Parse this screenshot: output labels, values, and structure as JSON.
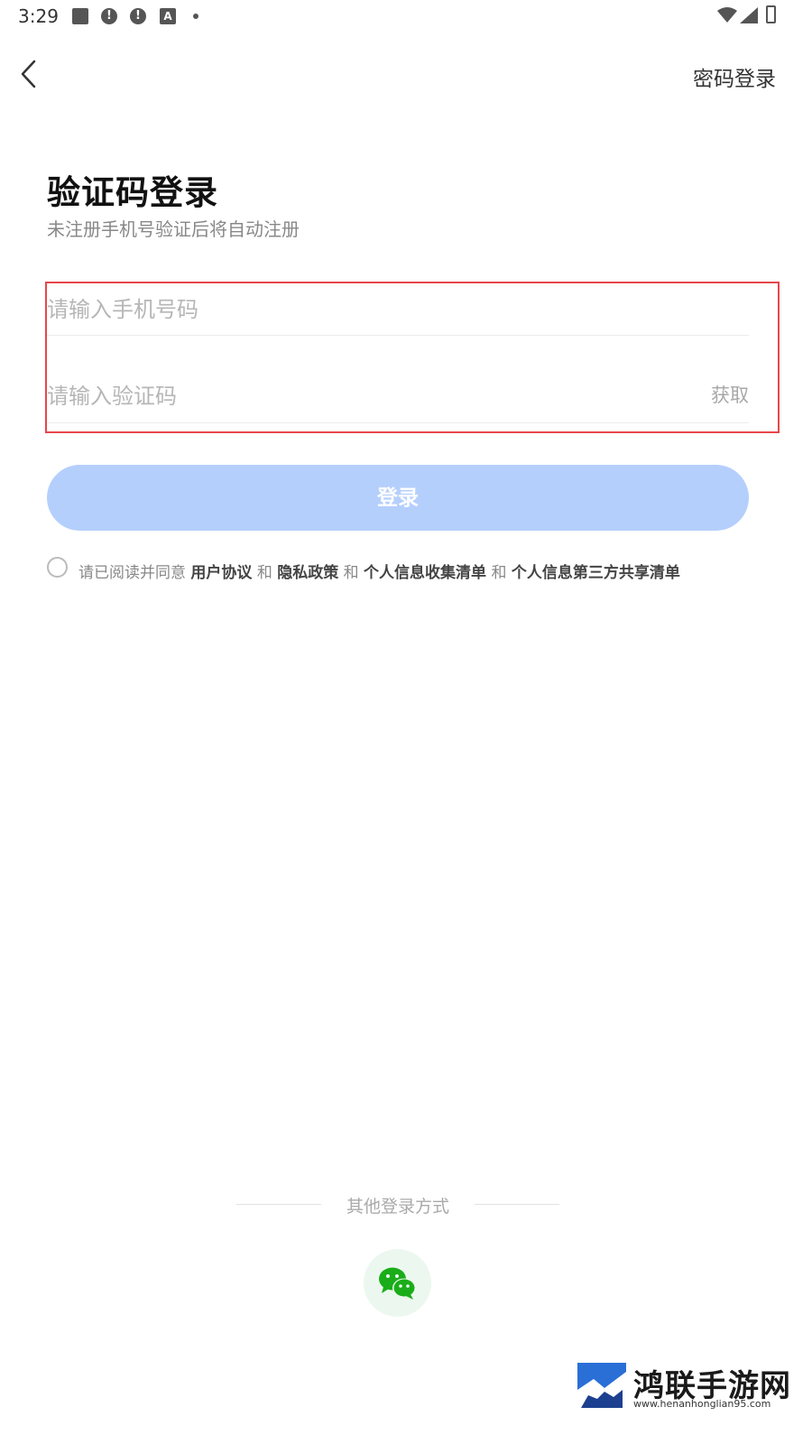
{
  "status_bar": {
    "time": "3:29",
    "icons": [
      "image-icon",
      "alert-icon",
      "alert-icon",
      "a-icon",
      "dot-icon",
      "wifi-icon",
      "signal-icon",
      "battery-charging-icon"
    ],
    "alert_glyph": "!",
    "a_glyph": "A"
  },
  "nav": {
    "back_icon": "chevron-left-icon",
    "password_login": "密码登录"
  },
  "header": {
    "title": "验证码登录",
    "subtitle": "未注册手机号验证后将自动注册"
  },
  "form": {
    "phone_placeholder": "请输入手机号码",
    "phone_value": "",
    "code_placeholder": "请输入验证码",
    "code_value": "",
    "get_code_label": "获取",
    "highlight_color": "#e5474b"
  },
  "login_button": {
    "label": "登录",
    "color": "#b5cffd"
  },
  "agreement": {
    "checked": false,
    "prefix": "请已阅读并同意",
    "user_agreement": "用户协议",
    "and1": "和",
    "privacy_policy": "隐私政策",
    "and2": "和",
    "info_collection": "个人信息收集清单",
    "and3": "和",
    "third_party_sharing": "个人信息第三方共享清单"
  },
  "other_login": {
    "label": "其他登录方式",
    "methods": [
      {
        "icon": "wechat-icon",
        "color": "#1aad19"
      }
    ]
  },
  "watermark": {
    "name": "鸿联手游网",
    "url": "www.henanhonglian95.com"
  }
}
